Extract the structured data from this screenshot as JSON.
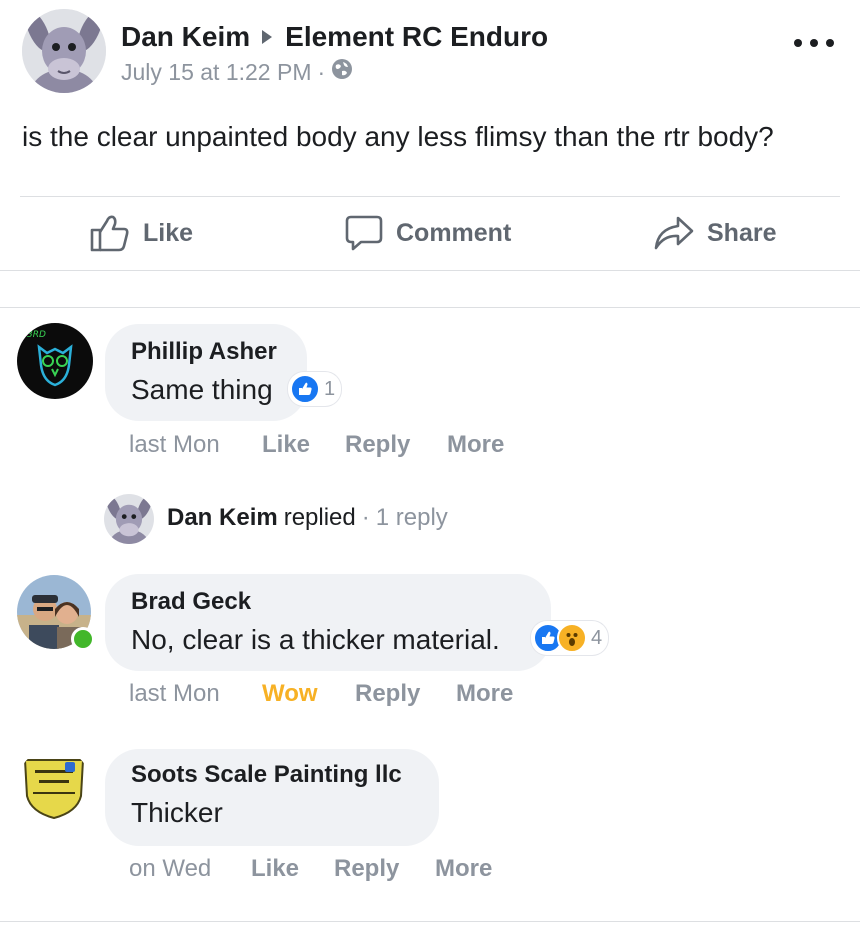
{
  "post": {
    "author": "Dan Keim",
    "group": "Element RC Enduro",
    "timestamp": "July 15 at 1:22 PM",
    "separator": "·",
    "privacy_icon": "globe-icon",
    "text": "is the clear unpainted body any less flimsy than the rtr body?",
    "more_icon": "more-dots-icon"
  },
  "actions": {
    "like": "Like",
    "comment": "Comment",
    "share": "Share"
  },
  "comments": [
    {
      "author": "Phillip Asher",
      "text": "Same thing",
      "reaction_count": "1",
      "time": "last Mon",
      "like": "Like",
      "reply": "Reply",
      "more": "More",
      "avatar_badge": "3RD"
    },
    {
      "author": "Brad Geck",
      "text": "No, clear is a thicker material.",
      "reaction_count": "4",
      "time": "last Mon",
      "like": "Wow",
      "reply": "Reply",
      "more": "More",
      "online": true
    },
    {
      "author": "Soots Scale Painting llc",
      "text": "Thicker",
      "time": "on Wed",
      "like": "Like",
      "reply": "Reply",
      "more": "More"
    }
  ],
  "reply_summary": {
    "author": "Dan Keim",
    "verb": "replied",
    "separator": "·",
    "count": "1 reply"
  },
  "colors": {
    "like_blue": "#1877f2",
    "wow_yellow": "#f7b125",
    "online_green": "#42b72a",
    "secondary_text": "#8d949e",
    "bubble_bg": "#f0f2f5"
  }
}
